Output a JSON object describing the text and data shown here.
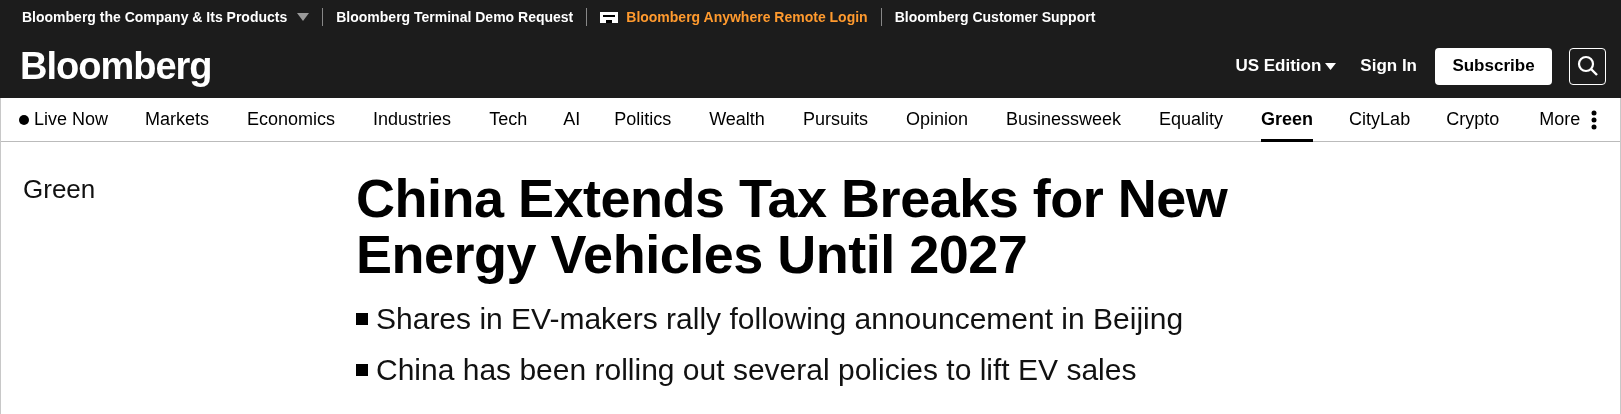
{
  "top_links": [
    {
      "label": "Bloomberg the Company & Its Products",
      "kind": "dropdown"
    },
    {
      "label": "Bloomberg Terminal Demo Request",
      "kind": "link"
    },
    {
      "label": "Bloomberg Anywhere Remote Login",
      "kind": "highlight"
    },
    {
      "label": "Bloomberg Customer Support",
      "kind": "link"
    }
  ],
  "header": {
    "logo": "Bloomberg",
    "edition": "US Edition",
    "sign_in": "Sign In",
    "subscribe": "Subscribe"
  },
  "nav": [
    {
      "label": "Live Now",
      "kind": "live",
      "selected": false
    },
    {
      "label": "Markets",
      "kind": "link",
      "selected": false
    },
    {
      "label": "Economics",
      "kind": "link",
      "selected": false
    },
    {
      "label": "Industries",
      "kind": "link",
      "selected": false
    },
    {
      "label": "Tech",
      "kind": "link",
      "selected": false
    },
    {
      "label": "AI",
      "kind": "link",
      "selected": false
    },
    {
      "label": "Politics",
      "kind": "link",
      "selected": false
    },
    {
      "label": "Wealth",
      "kind": "link",
      "selected": false
    },
    {
      "label": "Pursuits",
      "kind": "link",
      "selected": false
    },
    {
      "label": "Opinion",
      "kind": "link",
      "selected": false
    },
    {
      "label": "Businessweek",
      "kind": "link",
      "selected": false
    },
    {
      "label": "Equality",
      "kind": "link",
      "selected": false
    },
    {
      "label": "Green",
      "kind": "link",
      "selected": true
    },
    {
      "label": "CityLab",
      "kind": "link",
      "selected": false
    },
    {
      "label": "Crypto",
      "kind": "link",
      "selected": false
    },
    {
      "label": "More",
      "kind": "more",
      "selected": false
    }
  ],
  "article": {
    "section": "Green",
    "headline": "China Extends Tax Breaks for New Energy Vehicles Until 2027",
    "bullets": [
      "Shares in EV-makers rally following announcement in Beijing",
      "China has been rolling out several policies to lift EV sales"
    ]
  }
}
